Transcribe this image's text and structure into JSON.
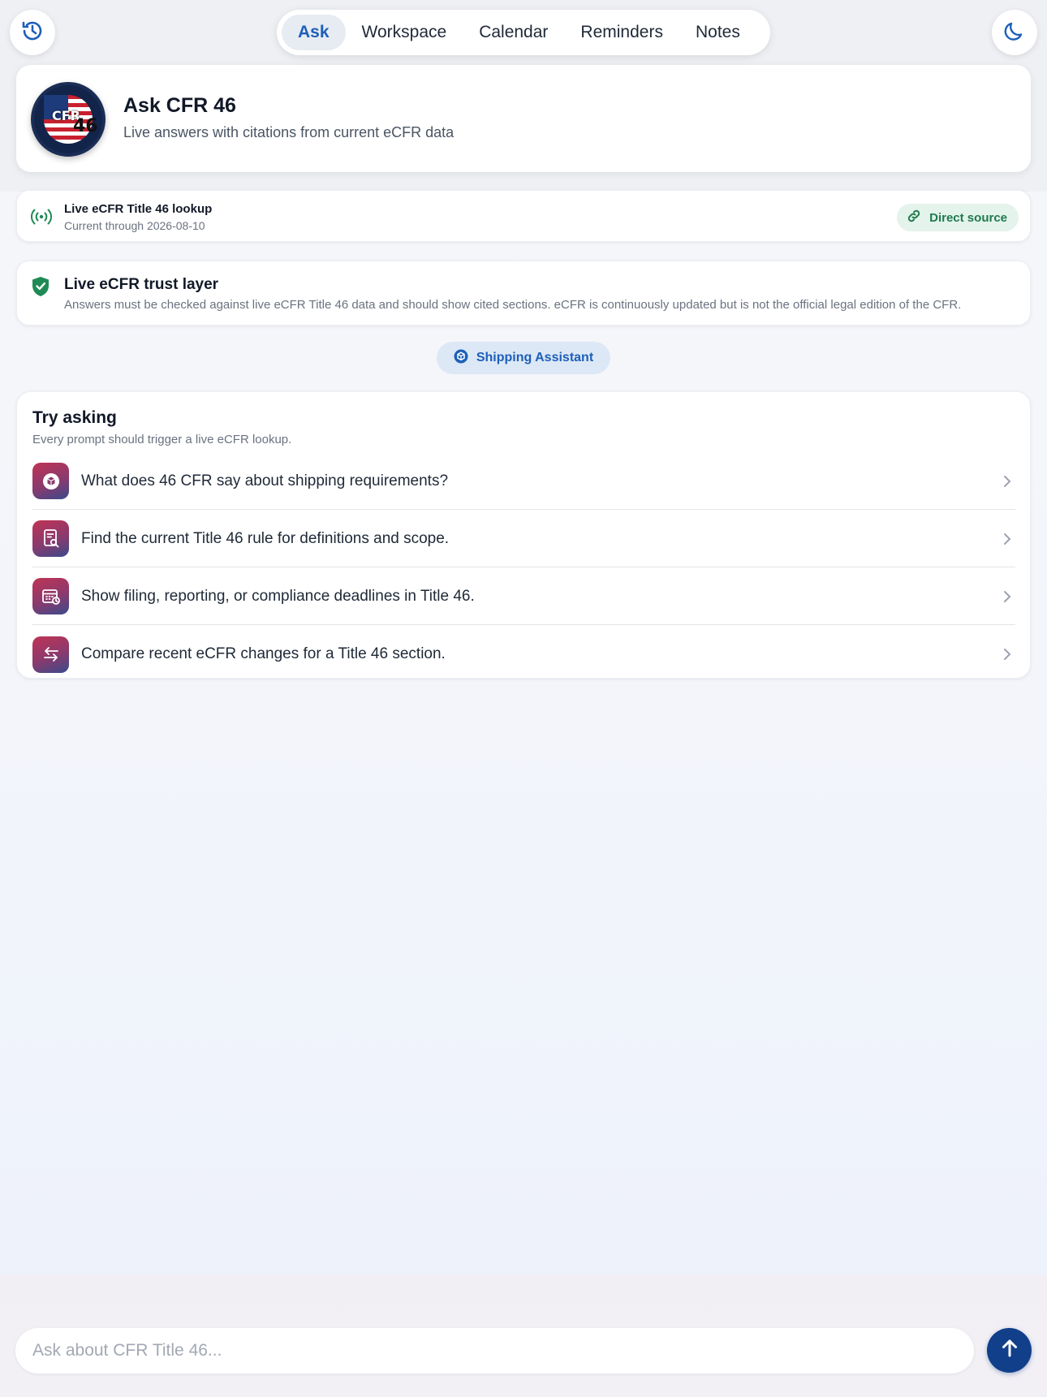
{
  "nav": {
    "history_icon": "history-icon",
    "theme_icon": "moon-icon",
    "tabs": [
      {
        "label": "Ask",
        "active": true
      },
      {
        "label": "Workspace",
        "active": false
      },
      {
        "label": "Calendar",
        "active": false
      },
      {
        "label": "Reminders",
        "active": false
      },
      {
        "label": "Notes",
        "active": false
      }
    ]
  },
  "header": {
    "logo_text": "CFR",
    "logo_number": "46",
    "title": "Ask CFR 46",
    "subtitle": "Live answers with citations from current eCFR data"
  },
  "lookup": {
    "icon": "broadcast-icon",
    "title": "Live eCFR Title 46 lookup",
    "subtitle": "Current through 2026-08-10",
    "source_label": "Direct source",
    "source_icon": "link-icon"
  },
  "trust": {
    "icon": "shield-check-icon",
    "title": "Live eCFR trust layer",
    "body": "Answers must be checked against live eCFR Title 46 data and should show cited sections. eCFR is continuously updated but is not the official legal edition of the CFR."
  },
  "assistant": {
    "label": "Shipping Assistant",
    "icon": "cube-icon"
  },
  "try_asking": {
    "title": "Try asking",
    "subtitle": "Every prompt should trigger a live eCFR lookup.",
    "prompts": [
      {
        "text": "What does 46 CFR say about shipping requirements?",
        "icon": "cube-icon"
      },
      {
        "text": "Find the current Title 46 rule for definitions and scope.",
        "icon": "document-search-icon"
      },
      {
        "text": "Show filing, reporting, or compliance deadlines in Title 46.",
        "icon": "calendar-clock-icon"
      },
      {
        "text": "Compare recent eCFR changes for a Title 46 section.",
        "icon": "arrows-compare-icon"
      }
    ]
  },
  "composer": {
    "placeholder": "Ask about CFR Title 46...",
    "send_icon": "arrow-up-icon"
  },
  "colors": {
    "accent": "#1d5fb8",
    "send_button": "#113f8a",
    "source_green": "#1f7a4d",
    "shield_green": "#1f8a55"
  }
}
